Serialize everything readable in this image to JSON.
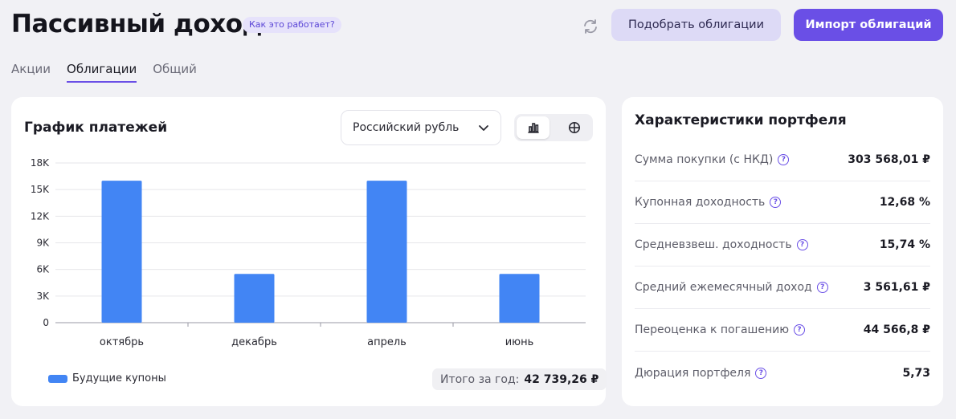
{
  "header": {
    "title": "Пассивный доход",
    "how_label": "Как это работает?",
    "select_button": "Подобрать облигации",
    "import_button": "Импорт облигаций",
    "accent_color": "#6a4fe6"
  },
  "tabs": [
    {
      "label": "Акции",
      "active": false
    },
    {
      "label": "Облигации",
      "active": true
    },
    {
      "label": "Общий",
      "active": false
    }
  ],
  "payments": {
    "title": "График платежей",
    "currency": "Российский рубль",
    "legend_label": "Будущие купоны",
    "total_label": "Итого за год:",
    "total_value": "42 739,26 ₽",
    "view_icons": [
      "bar-chart-icon",
      "grid-icon"
    ]
  },
  "chart_data": {
    "type": "bar",
    "categories": [
      "октябрь",
      "декабрь",
      "апрель",
      "июнь"
    ],
    "values": [
      16000,
      5500,
      16000,
      5500
    ],
    "y_ticks": [
      "0",
      "3K",
      "6K",
      "9K",
      "12K",
      "15K",
      "18K"
    ],
    "ylim": [
      0,
      18000
    ],
    "series_name": "Будущие купоны",
    "color": "#4285f4",
    "grid": true
  },
  "stats": {
    "title": "Характеристики портфеля",
    "rows": [
      {
        "label": "Сумма покупки (с НКД)",
        "value": "303 568,01 ₽"
      },
      {
        "label": "Купонная доходность",
        "value": "12,68 %"
      },
      {
        "label": "Средневзвеш. доходность",
        "value": "15,74 %"
      },
      {
        "label": "Средний ежемесячный доход",
        "value": "3 561,61 ₽"
      },
      {
        "label": "Переоценка к погашению",
        "value": "44 566,8 ₽"
      },
      {
        "label": "Дюрация портфеля",
        "value": "5,73"
      }
    ]
  }
}
